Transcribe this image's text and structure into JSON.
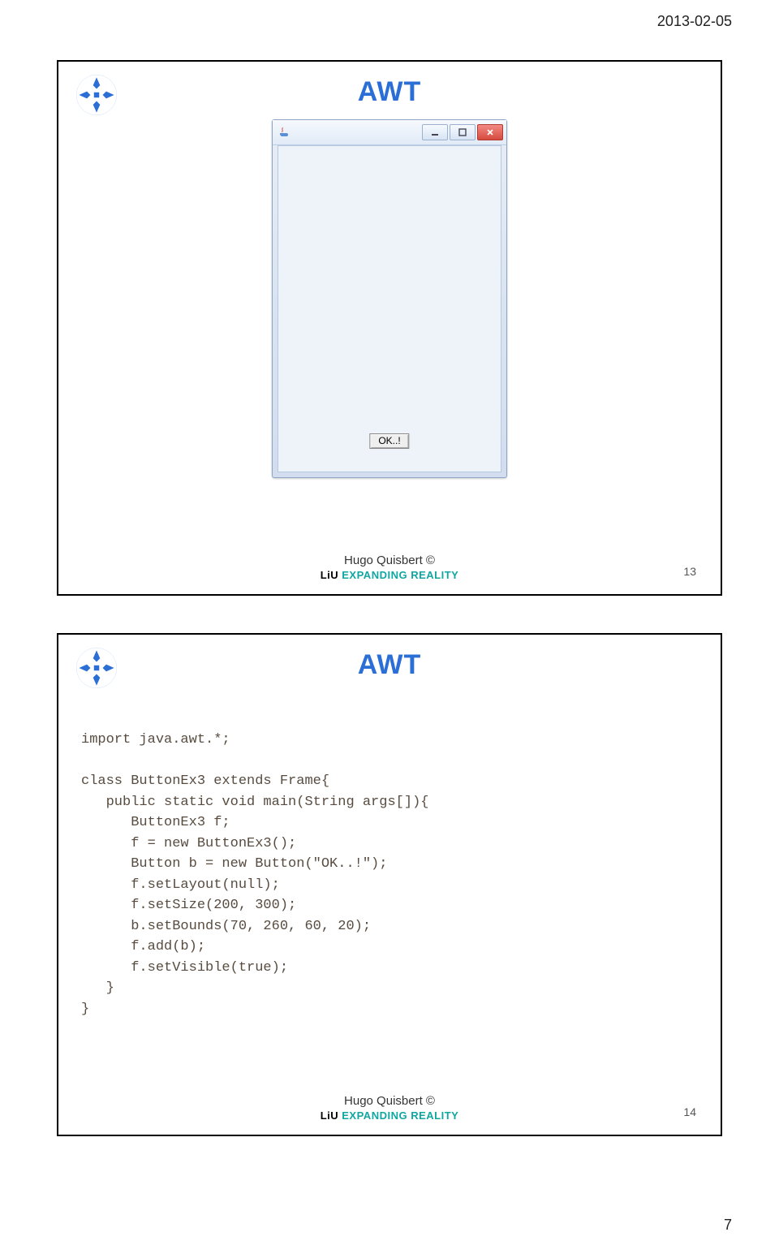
{
  "page_date": "2013‑02‑05",
  "page_number": "7",
  "slide1": {
    "title": "AWT",
    "window": {
      "icon_name": "java-cup-icon",
      "ok_label": "OK..!"
    },
    "footer_copyright": "Hugo Quisbert ©",
    "footer_brand_prefix": "LiU",
    "footer_brand_tagline": " EXPANDING REALITY",
    "footer_page": "13"
  },
  "slide2": {
    "title": "AWT",
    "code": "import java.awt.*;\n\nclass ButtonEx3 extends Frame{\n   public static void main(String args[]){\n      ButtonEx3 f;\n      f = new ButtonEx3();\n      Button b = new Button(\"OK..!\");\n      f.setLayout(null);\n      f.setSize(200, 300);\n      b.setBounds(70, 260, 60, 20);\n      f.add(b);\n      f.setVisible(true);\n   }\n}",
    "footer_copyright": "Hugo Quisbert ©",
    "footer_brand_prefix": "LiU",
    "footer_brand_tagline": " EXPANDING REALITY",
    "footer_page": "14"
  }
}
